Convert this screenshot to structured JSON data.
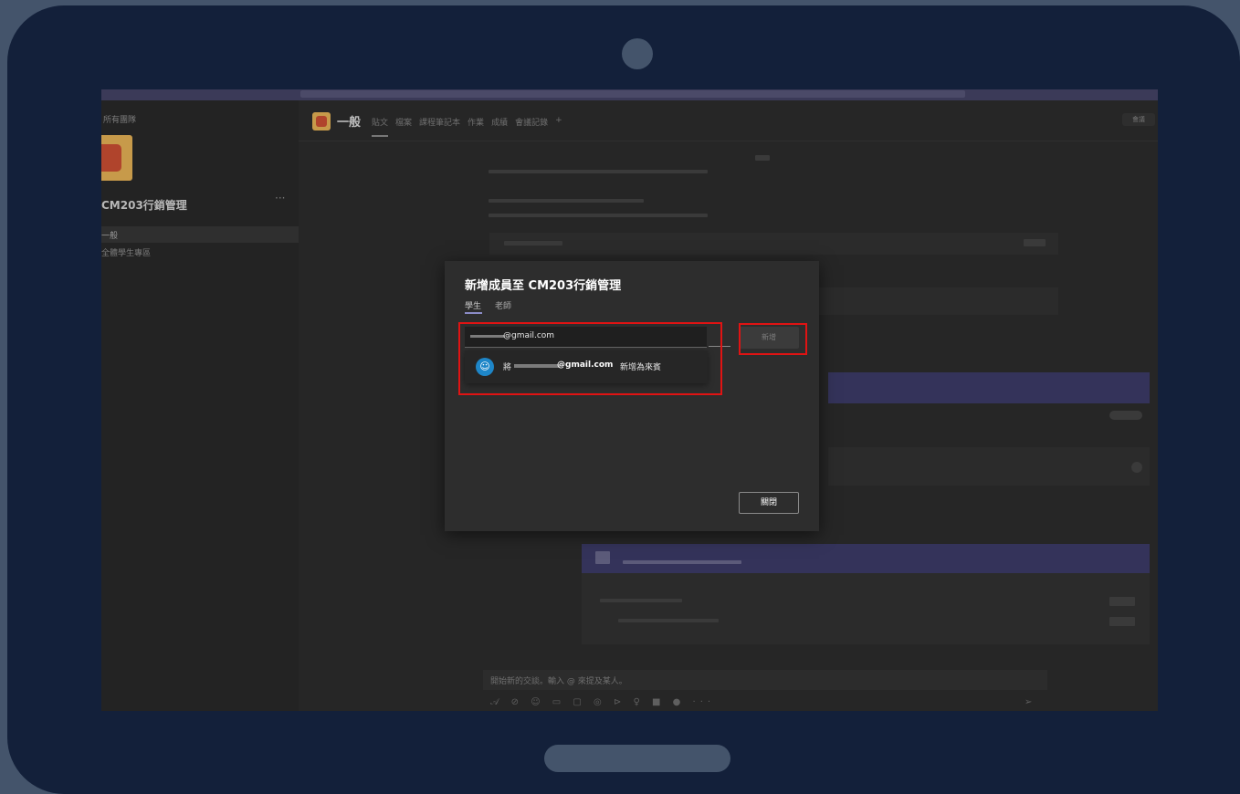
{
  "sidebar": {
    "back_label": "所有團隊",
    "team_name": "CM203行銷管理",
    "more": "···",
    "channel_selected": "一般",
    "channel_2": "全體學生專區"
  },
  "channel_header": {
    "title": "一般",
    "tabs": [
      "貼文",
      "檔案",
      "課程筆記本",
      "作業",
      "成績",
      "會議記錄",
      "+"
    ],
    "right_button": "會議"
  },
  "dialog": {
    "title": "新增成員至 CM203行銷管理",
    "tab_students": "學生",
    "tab_teachers": "老師",
    "email_value": "@gmail.com",
    "add_button": "新增",
    "suggestion_prefix": "將",
    "suggestion_email": "@gmail.com",
    "suggestion_suffix": "新增為來賓",
    "close_button": "關閉"
  },
  "compose": {
    "placeholder": "開始新的交談。輸入 @ 來提及某人。"
  },
  "icons": {
    "add-guest-icon": "person-plus",
    "format-icons": "𝒜 ⊘ ☺ ▭ ▢ ◎ ⊳ ♀ ■ ● ···",
    "send-icon": "➢"
  },
  "colors": {
    "tablet_frame": "#13203a",
    "backdrop": "#44546b",
    "highlight_box": "#e01313",
    "accent": "#8b8cc7",
    "guest_avatar": "#1e86c8"
  }
}
